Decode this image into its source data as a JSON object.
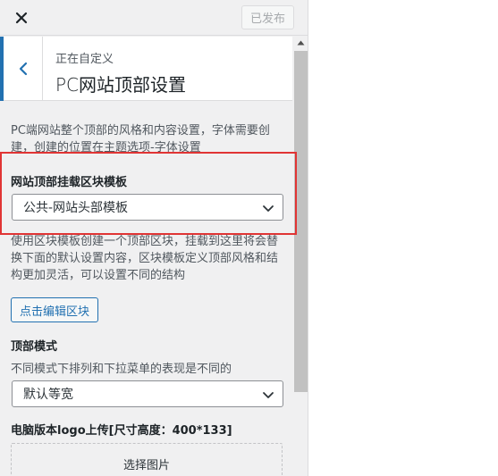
{
  "topbar": {
    "close_icon": "close-icon",
    "publish_label": "已发布"
  },
  "header": {
    "subtitle": "正在自定义",
    "title": "PC网站顶部设置",
    "back_icon": "chevron-left-icon"
  },
  "intro": {
    "text": "PC端网站整个顶部的风格和内容设置，字体需要创建，创建的位置在主题选项-字体设置"
  },
  "header_template": {
    "label": "网站顶部挂载区块模板",
    "selected": "公共-网站头部模板",
    "description": "使用区块模板创建一个顶部区块，挂载到这里将会替换下面的默认设置内容，区块模板定义顶部风格和结构更加灵活，可以设置不同的结构",
    "edit_button": "点击编辑区块"
  },
  "header_mode": {
    "label": "顶部模式",
    "description": "不同模式下排列和下拉菜单的表现是不同的",
    "selected": "默认等宽"
  },
  "logo_upload": {
    "label": "电脑版本logo上传[尺寸高度：400*133]",
    "button": "选择图片"
  },
  "colors": {
    "accent": "#2271b1",
    "highlight_border": "#e03434",
    "panel_bg": "#f0f0f1"
  }
}
